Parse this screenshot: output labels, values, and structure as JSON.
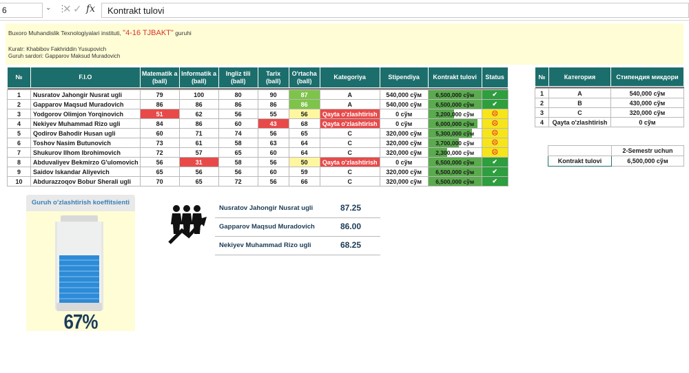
{
  "formula_bar": {
    "name_box": "6",
    "fx": "fx",
    "formula": "Kontrakt tulovi"
  },
  "header": {
    "institute": "Buxoro Muhandislik Texnologiyalari instituti,",
    "group_name": "\"4-16 TJBAKT\"",
    "group_suffix": "guruhi",
    "curator": "Kuratr: Khabibov Fakhriddin Yusupovich",
    "leader": "Guruh sardori: Gapparov Maksud Muradovich"
  },
  "main_table": {
    "headers": [
      "№",
      "F.I.O",
      "Matematik a (ball)",
      "Informatik a (ball)",
      "Ingliz tili (ball)",
      "Tarix (ball)",
      "O'rtacha (ball)",
      "Kategoriya",
      "Stipendiya",
      "Kontrakt tulovi",
      "Status"
    ],
    "rows": [
      {
        "n": "1",
        "name": "Nusratov Jahongir Nusrat ugli",
        "mat": "79",
        "inf": "100",
        "eng": "80",
        "tar": "90",
        "avg": "87",
        "cat": "A",
        "stip": "540,000 сўм",
        "contract": "6,500,000 сўм",
        "paid": 1.0,
        "status": "✔"
      },
      {
        "n": "2",
        "name": "Gapparov Maqsud Muradovich",
        "mat": "86",
        "inf": "86",
        "eng": "86",
        "tar": "86",
        "avg": "86",
        "cat": "A",
        "stip": "540,000 сўм",
        "contract": "6,500,000 сўм",
        "paid": 1.0,
        "status": "✔"
      },
      {
        "n": "3",
        "name": "Yodgorov Olimjon Yorqinovich",
        "mat": "51",
        "inf": "62",
        "eng": "56",
        "tar": "55",
        "avg": "56",
        "cat": "Qayta o'zlashtirish",
        "stip": "0 сўм",
        "contract": "3,200,000 сўм",
        "paid": 0.49,
        "status": "☹"
      },
      {
        "n": "4",
        "name": "Nekiyev Muhammad Rizo ugli",
        "mat": "84",
        "inf": "86",
        "eng": "60",
        "tar": "43",
        "avg": "68",
        "cat": "Qayta o'zlashtirish",
        "stip": "0 сўм",
        "contract": "6,000,000 сўм",
        "paid": 0.92,
        "status": "☹"
      },
      {
        "n": "5",
        "name": "Qodirov Bahodir Husan ugli",
        "mat": "60",
        "inf": "71",
        "eng": "74",
        "tar": "56",
        "avg": "65",
        "cat": "C",
        "stip": "320,000 сўм",
        "contract": "5,300,000 сўм",
        "paid": 0.82,
        "status": "☹"
      },
      {
        "n": "6",
        "name": "Toshov Nasim Butunovich",
        "mat": "73",
        "inf": "61",
        "eng": "58",
        "tar": "63",
        "avg": "64",
        "cat": "C",
        "stip": "320,000 сўм",
        "contract": "3,700,000 сўм",
        "paid": 0.57,
        "status": "☹"
      },
      {
        "n": "7",
        "name": "Shukurov Ilhom Ibrohimovich",
        "mat": "72",
        "inf": "57",
        "eng": "65",
        "tar": "60",
        "avg": "64",
        "cat": "C",
        "stip": "320,000 сўм",
        "contract": "2,300,000 сўм",
        "paid": 0.35,
        "status": "☹"
      },
      {
        "n": "8",
        "name": "Abduvaliyev Bekmirzo G'ulomovich",
        "mat": "56",
        "inf": "31",
        "eng": "58",
        "tar": "56",
        "avg": "50",
        "cat": "Qayta o'zlashtirish",
        "stip": "0 сўм",
        "contract": "6,500,000 сўм",
        "paid": 1.0,
        "status": "✔"
      },
      {
        "n": "9",
        "name": "Saidov Iskandar Aliyevich",
        "mat": "65",
        "inf": "56",
        "eng": "56",
        "tar": "60",
        "avg": "59",
        "cat": "C",
        "stip": "320,000 сўм",
        "contract": "6,500,000 сўм",
        "paid": 1.0,
        "status": "✔"
      },
      {
        "n": "10",
        "name": "Abdurazzoqov Bobur Sherali ugli",
        "mat": "70",
        "inf": "65",
        "eng": "72",
        "tar": "56",
        "avg": "66",
        "cat": "C",
        "stip": "320,000 сўм",
        "contract": "6,500,000 сўм",
        "paid": 1.0,
        "status": "✔"
      }
    ]
  },
  "side_table": {
    "headers": [
      "№",
      "Категория",
      "Стипендия микдори"
    ],
    "rows": [
      {
        "n": "1",
        "cat": "A",
        "amount": "540,000 сўм"
      },
      {
        "n": "2",
        "cat": "B",
        "amount": "430,000 сўм"
      },
      {
        "n": "3",
        "cat": "C",
        "amount": "320,000 сўм"
      },
      {
        "n": "4",
        "cat": "Qayta o'zlashtirish",
        "amount": "0 сўм"
      }
    ]
  },
  "info_table": {
    "semester": "2-Semestr uchun",
    "label": "Kontrakt tulovi",
    "value": "6,500,000 сўм"
  },
  "gauge": {
    "title": "Guruh o'zlashtirish koeffitsienti",
    "value": "67%",
    "level": 0.67,
    "fill_color": "#2e8bd6"
  },
  "top_students": [
    {
      "name": "Nusratov Jahongir Nusrat ugli",
      "score": "87.25"
    },
    {
      "name": "Gapparov Maqsud Muradovich",
      "score": "86.00"
    },
    {
      "name": "Nekiyev Muhammad Rizo ugli",
      "score": "68.25"
    }
  ],
  "colors": {
    "header_teal": "#1c6e6c",
    "low_score_red": "#e84a4a",
    "ok_green": "#2e9e3e",
    "warn_yellow": "#f7e51b",
    "banner_yellow": "#fffdd6"
  }
}
